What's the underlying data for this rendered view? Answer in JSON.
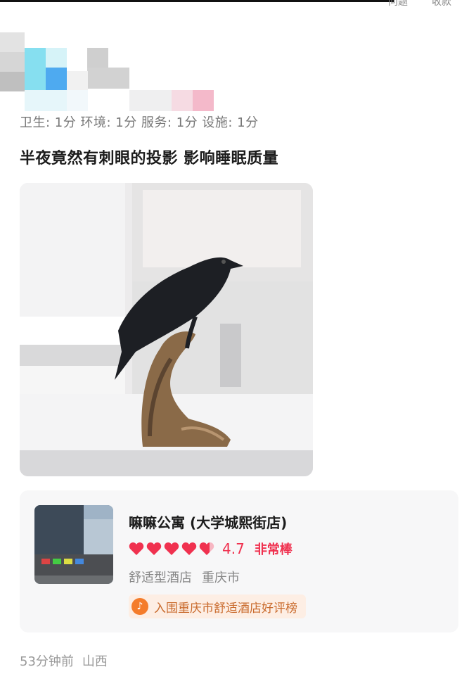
{
  "top_bar": {
    "left_text": "问题",
    "right_text": "收款"
  },
  "review": {
    "scores": "卫生: 1分  环境: 1分  服务: 1分  设施: 1分",
    "headline": "半夜竟然有刺眼的投影 影响睡眠质量"
  },
  "hotel_card": {
    "name": "嘛嘛公寓 (大学城熙街店)",
    "hearts": 5,
    "rating_score": "4.7",
    "rating_text": "非常棒",
    "type": "舒适型酒店",
    "city": "重庆市",
    "badge_text": "入围重庆市舒适酒店好评榜",
    "rating_color": "#f0314f",
    "badge_color": "#f47c2b"
  },
  "post_meta": {
    "time_ago": "53分钟前",
    "location": "山西"
  }
}
